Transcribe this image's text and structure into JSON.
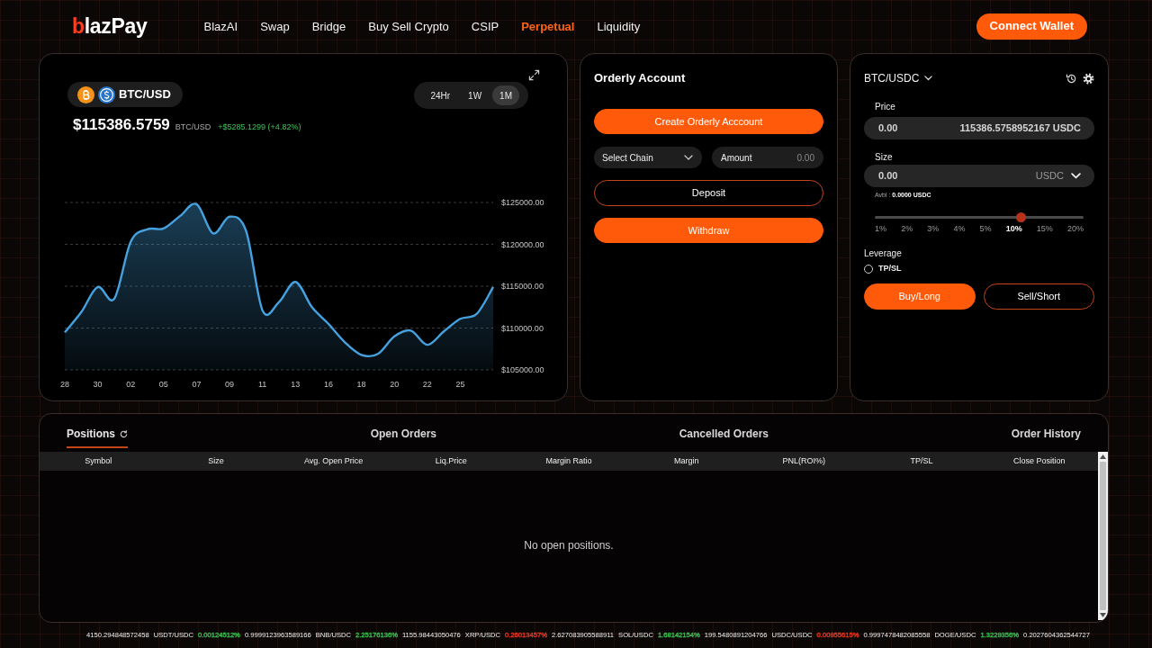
{
  "header": {
    "logo": "blazPay",
    "nav": [
      {
        "label": "BlazAI",
        "selected": false
      },
      {
        "label": "Swap",
        "selected": false
      },
      {
        "label": "Bridge",
        "selected": false
      },
      {
        "label": "Buy Sell Crypto",
        "selected": false
      },
      {
        "label": "CSIP",
        "selected": false
      },
      {
        "label": "Perpetual",
        "selected": true
      },
      {
        "label": "Liquidity",
        "selected": false
      }
    ],
    "connect_button": "Connect Wallet"
  },
  "chart_panel": {
    "pair": "BTC/USD",
    "timeframes": [
      {
        "label": "24Hr",
        "selected": false
      },
      {
        "label": "1W",
        "selected": false
      },
      {
        "label": "1M",
        "selected": true
      }
    ],
    "price": "$115386.5759",
    "price_pair": "BTC/USD",
    "change": "+$5285.1299 (+4.82%)",
    "chart_data": {
      "type": "area",
      "categories": [
        "28",
        null,
        "30",
        null,
        "02",
        null,
        "05",
        null,
        "07",
        null,
        "09",
        null,
        "11",
        null,
        "13",
        null,
        "16",
        null,
        "18",
        null,
        "20",
        null,
        "22",
        null,
        "25",
        null,
        null
      ],
      "series": [
        {
          "color": "#45a2df",
          "values": [
            109500,
            111900,
            114900,
            113500,
            120300,
            121800,
            121900,
            123400,
            124800,
            121300,
            123300,
            121600,
            112100,
            113100,
            115500,
            112500,
            110500,
            108300,
            106800,
            106900,
            109000,
            109700,
            108000,
            109600,
            111100,
            111700,
            114900
          ]
        }
      ],
      "ylim": [
        105000,
        125000
      ],
      "yticks": [
        {
          "value": 125000,
          "label": "$125000.00"
        },
        {
          "value": 120000,
          "label": "$120000.00"
        },
        {
          "value": 115000,
          "label": "$115000.00"
        },
        {
          "value": 110000,
          "label": "$110000.00"
        },
        {
          "value": 105000,
          "label": "$105000.00"
        }
      ],
      "grid": true
    }
  },
  "orderly_panel": {
    "title": "Orderly Account",
    "create_button": "Create Orderly Acccount",
    "chain_select": "Select Chain",
    "amount": {
      "label": "Amount",
      "placeholder": "0.00"
    },
    "deposit_button": "Deposit",
    "withdraw_button": "Withdraw"
  },
  "trade_panel": {
    "pair": "BTC/USDC",
    "price": {
      "label": "Price",
      "value": "0.00",
      "quote": "115386.5758952167 USDC"
    },
    "size": {
      "label": "Size",
      "value": "0.00",
      "unit": "USDC"
    },
    "available": "Avbl : **0.0000 USDC**",
    "slider": {
      "level": 0.7,
      "marks": [
        {
          "label": "1%",
          "selected": false
        },
        {
          "label": "2%",
          "selected": false
        },
        {
          "label": "3%",
          "selected": false
        },
        {
          "label": "4%",
          "selected": false
        },
        {
          "label": "5%",
          "selected": false
        },
        {
          "label": "10%",
          "selected": true
        },
        {
          "label": "15%",
          "selected": false
        },
        {
          "label": "20%",
          "selected": false
        }
      ]
    },
    "leverage_label": "Leverage",
    "tpsl": {
      "label": "TP/SL",
      "checked": false
    },
    "buy_button": "Buy/Long",
    "sell_button": "Sell/Short"
  },
  "positions_panel": {
    "tabs": [
      {
        "label": "Positions",
        "selected": true,
        "refreshable": true
      },
      {
        "label": "Open Orders",
        "selected": false,
        "refreshable": false
      },
      {
        "label": "Cancelled Orders",
        "selected": false,
        "refreshable": false
      },
      {
        "label": "Order History",
        "selected": false,
        "refreshable": false
      }
    ],
    "columns": [
      "Symbol",
      "Size",
      "Avg. Open Price",
      "Liq.Price",
      "Margin Ratio",
      "Margin",
      "PNL(ROI%)",
      "TP/SL",
      "Close Position"
    ],
    "empty_message": "No open positions."
  },
  "ticker": [
    {
      "price": "4150.294848572458"
    },
    {
      "pair": "USDT/USDC",
      "change": "0.00124512%",
      "color": "#35b84a",
      "price": "0.9999123963589166"
    },
    {
      "pair": "BNB/USDC",
      "change": "2.25176136%",
      "color": "#35b84a",
      "price": "1155.98443050476"
    },
    {
      "pair": "XRP/USDC",
      "change": "0.26013457%",
      "color": "#e0341f",
      "price": "2.627083905588911"
    },
    {
      "pair": "SOL/USDC",
      "change": "1.68142154%",
      "color": "#35b84a",
      "price": "199.5480891204766"
    },
    {
      "pair": "USDC/USDC",
      "change": "0.00955615%",
      "color": "#e0341f",
      "price": "0.9997478482085558"
    },
    {
      "pair": "DOGE/USDC",
      "change": "1.3229356%",
      "color": "#35b84a",
      "price": "0.2027604362544727"
    }
  ]
}
